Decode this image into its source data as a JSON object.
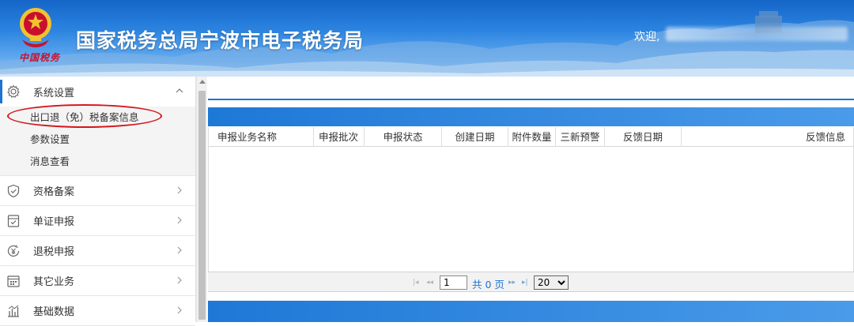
{
  "header": {
    "site_title": "国家税务总局宁波市电子税务局",
    "calligraphy": "中国税务",
    "welcome_label": "欢迎,"
  },
  "sidebar": {
    "groups": [
      {
        "label": "系统设置",
        "icon": "gear-icon",
        "expanded": true,
        "items": [
          {
            "label": "出口退（免）税备案信息",
            "highlighted": true
          },
          {
            "label": "参数设置"
          },
          {
            "label": "消息查看"
          }
        ]
      },
      {
        "label": "资格备案",
        "icon": "shield-check-icon"
      },
      {
        "label": "单证申报",
        "icon": "document-check-icon"
      },
      {
        "label": "退税申报",
        "icon": "refund-yen-icon"
      },
      {
        "label": "其它业务",
        "icon": "calendar-grid-icon"
      },
      {
        "label": "基础数据",
        "icon": "bar-chart-icon"
      }
    ]
  },
  "table": {
    "columns": [
      "申报业务名称",
      "申报批次",
      "申报状态",
      "创建日期",
      "附件数量",
      "三新预警",
      "反馈日期",
      "反馈信息"
    ],
    "rows": []
  },
  "pager": {
    "current_page": "1",
    "total_text": "共 0 页",
    "page_size": "20",
    "page_size_options": [
      "20"
    ]
  },
  "colors": {
    "accent": "#1e73d2",
    "highlight_ring": "#d4161c",
    "header_top": "#1466c8"
  }
}
